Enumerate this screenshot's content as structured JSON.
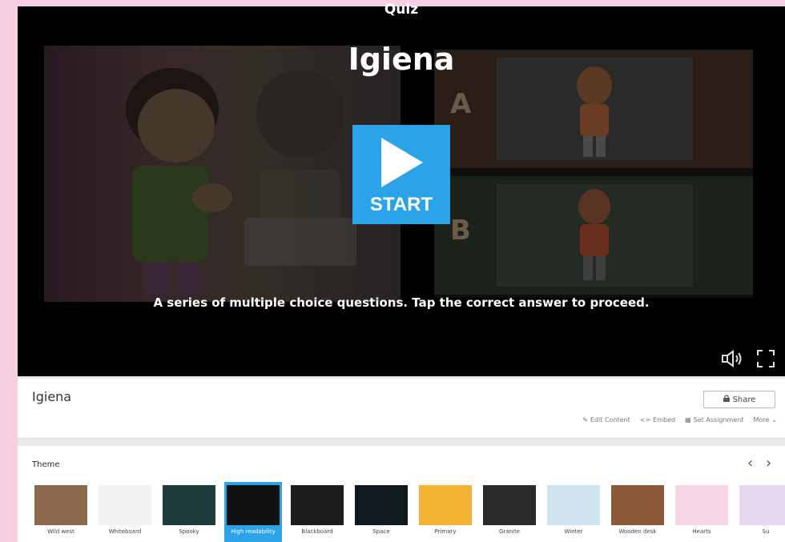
{
  "player": {
    "quiz_label": "Quiz",
    "title": "Igiena",
    "start_label": "START",
    "description": "A series of multiple choice questions. Tap the correct answer to proceed.",
    "answers": [
      {
        "letter": "A"
      },
      {
        "letter": "B"
      }
    ]
  },
  "info": {
    "title": "Igiena",
    "share_label": "Share",
    "actions": [
      "Edit Content",
      "Embed",
      "Set Assignment",
      "More"
    ]
  },
  "theme": {
    "label": "Theme",
    "prev": "‹",
    "next": "›",
    "items": [
      {
        "name": "Wild west",
        "selected": false,
        "color": "#8a6a4a"
      },
      {
        "name": "Whiteboard",
        "selected": false,
        "color": "#f2f2f2"
      },
      {
        "name": "Spooky",
        "selected": false,
        "color": "#1f3a3a"
      },
      {
        "name": "High readability",
        "selected": true,
        "color": "#111111"
      },
      {
        "name": "Blackboard",
        "selected": false,
        "color": "#1d1d1d"
      },
      {
        "name": "Space",
        "selected": false,
        "color": "#0f1a1f"
      },
      {
        "name": "Primary",
        "selected": false,
        "color": "#f2b233"
      },
      {
        "name": "Granite",
        "selected": false,
        "color": "#2a2a2a"
      },
      {
        "name": "Winter",
        "selected": false,
        "color": "#cfe3f0"
      },
      {
        "name": "Wooden desk",
        "selected": false,
        "color": "#8a5a36"
      },
      {
        "name": "Hearts",
        "selected": false,
        "color": "#f6d6e4"
      },
      {
        "name": "Su",
        "selected": false,
        "color": "#e6d8ef"
      }
    ]
  },
  "colors": {
    "accent": "#2aa3e8",
    "page_bg": "#f4cfe1"
  }
}
